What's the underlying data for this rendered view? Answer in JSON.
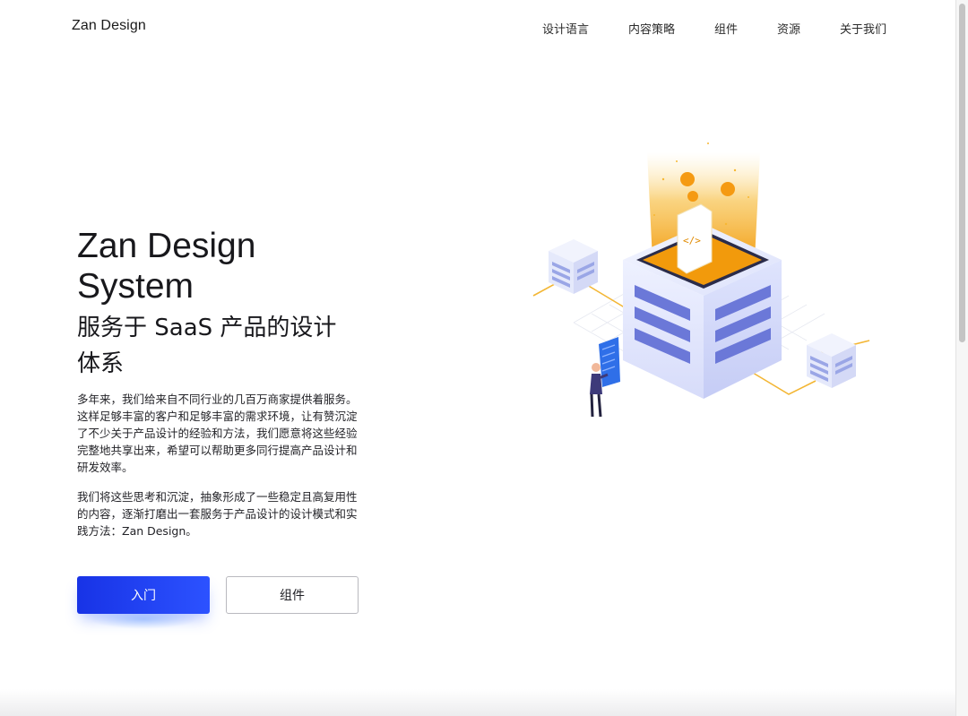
{
  "header": {
    "logo": "Zan Design",
    "nav": [
      {
        "label": "设计语言",
        "name": "nav-design-language"
      },
      {
        "label": "内容策略",
        "name": "nav-content-strategy"
      },
      {
        "label": "组件",
        "name": "nav-components"
      },
      {
        "label": "资源",
        "name": "nav-resources"
      },
      {
        "label": "关于我们",
        "name": "nav-about-us"
      }
    ]
  },
  "hero": {
    "title_line1": "Zan Design",
    "title_line2": "System",
    "subtitle_line1": "服务于 SaaS 产品的设计",
    "subtitle_line2": "体系",
    "paragraph_1": "多年来，我们给来自不同行业的几百万商家提供着服务。这样足够丰富的客户和足够丰富的需求环境，让有赞沉淀了不少关于产品设计的经验和方法，我们愿意将这些经验完整地共享出来，希望可以帮助更多同行提高产品设计和研发效率。",
    "paragraph_2": "我们将这些思考和沉淀，抽象形成了一些稳定且高复用性的内容，逐渐打磨出一套服务于产品设计的设计模式和实践方法：Zan Design。",
    "primary_button": "入门",
    "secondary_button": "组件"
  },
  "illustration": {
    "code_icon": "</>"
  },
  "colors": {
    "primary": "#2340ef",
    "accent_gold": "#f5a623",
    "server_stripe": "#6b78d8"
  }
}
